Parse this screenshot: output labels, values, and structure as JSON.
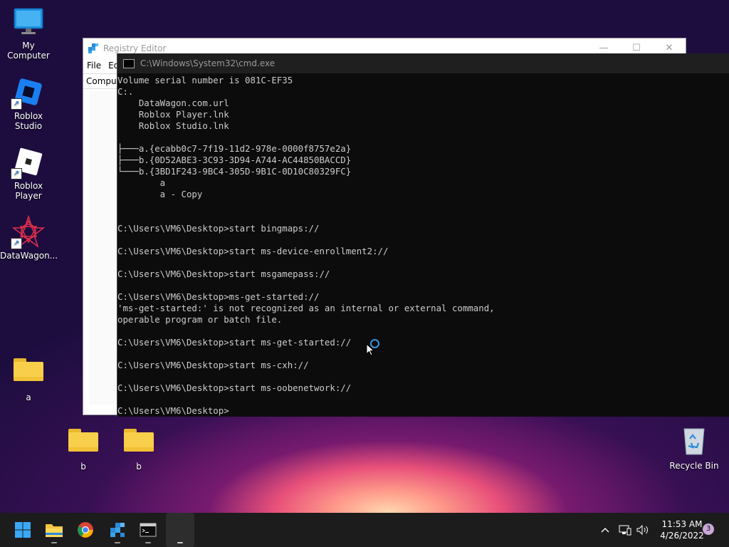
{
  "desktop": {
    "icons": [
      {
        "label": "My Computer"
      },
      {
        "label": "Roblox Studio"
      },
      {
        "label": "Roblox Player"
      },
      {
        "label": "DataWagon..."
      },
      {
        "label": "a"
      },
      {
        "label": "b"
      },
      {
        "label": "b"
      },
      {
        "label": "Recycle Bin"
      }
    ]
  },
  "regedit": {
    "title": "Registry Editor",
    "menu": [
      "File",
      "Ed"
    ],
    "address": "Comput"
  },
  "cmd": {
    "title": "C:\\Windows\\System32\\cmd.exe",
    "lines": [
      "Volume serial number is 081C-EF35",
      "C:.",
      "    DataWagon.com.url",
      "    Roblox Player.lnk",
      "    Roblox Studio.lnk",
      "",
      "├───a.{ecabb0c7-7f19-11d2-978e-0000f8757e2a}",
      "├───b.{0D52ABE3-3C93-3D94-A744-AC44850BACCD}",
      "└───b.{3BD1F243-9BC4-305D-9B1C-0D10C80329FC}",
      "        a",
      "        a - Copy",
      "",
      "",
      "C:\\Users\\VM6\\Desktop>start bingmaps://",
      "",
      "C:\\Users\\VM6\\Desktop>start ms-device-enrollment2://",
      "",
      "C:\\Users\\VM6\\Desktop>start msgamepass://",
      "",
      "C:\\Users\\VM6\\Desktop>ms-get-started://",
      "'ms-get-started:' is not recognized as an internal or external command,",
      "operable program or batch file.",
      "",
      "C:\\Users\\VM6\\Desktop>start ms-get-started://",
      "",
      "C:\\Users\\VM6\\Desktop>start ms-cxh://",
      "",
      "C:\\Users\\VM6\\Desktop>start ms-oobenetwork://",
      "",
      "C:\\Users\\VM6\\Desktop>"
    ]
  },
  "taskbar": {
    "time": "11:53 AM",
    "date": "4/26/2022",
    "notification_count": "3",
    "icons": [
      "start-icon",
      "file-explorer-icon",
      "chrome-icon",
      "regedit-icon",
      "cmd-icon",
      "blank-app-icon"
    ]
  },
  "colors": {
    "cmd_bg": "#0c0c0c",
    "cmd_text": "#cccccc",
    "taskbar": "#1c1c1c"
  }
}
